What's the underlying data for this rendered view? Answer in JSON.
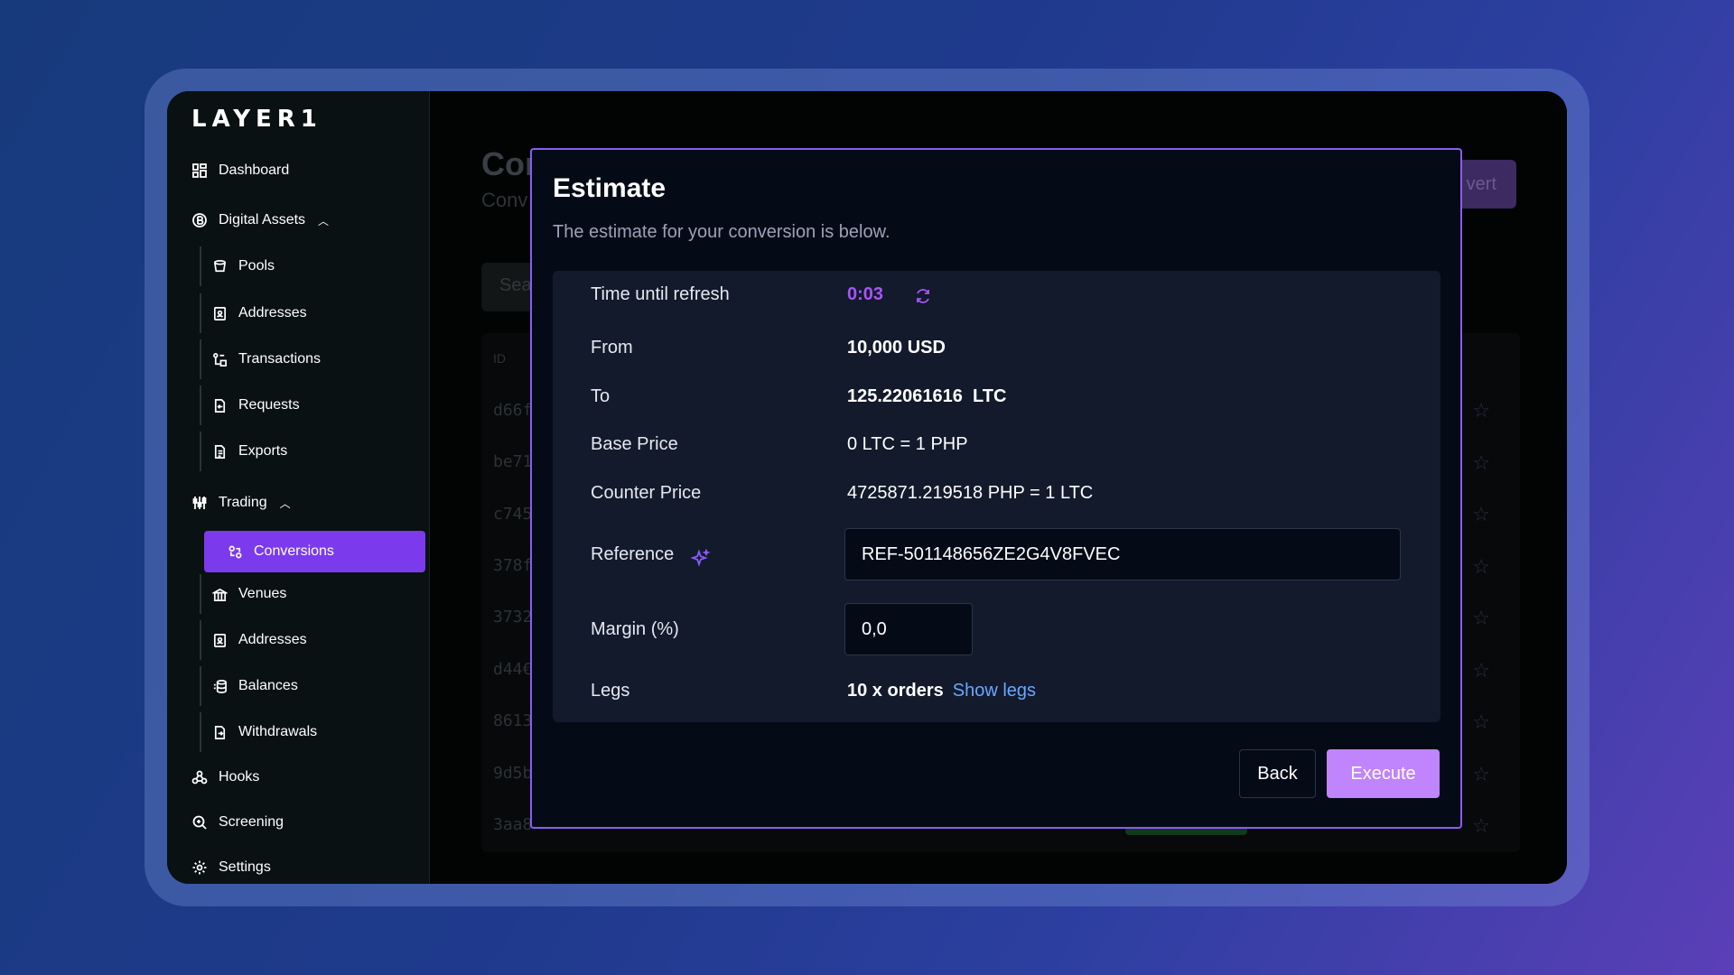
{
  "app": {
    "logo": "LAYER1"
  },
  "sidebar": {
    "dashboard": "Dashboard",
    "digital_assets": "Digital Assets",
    "digital_assets_items": [
      "Pools",
      "Addresses",
      "Transactions",
      "Requests",
      "Exports"
    ],
    "trading": "Trading",
    "trading_items": [
      "Conversions",
      "Venues",
      "Addresses",
      "Balances",
      "Withdrawals"
    ],
    "active_item": "Conversions",
    "hooks": "Hooks",
    "screening": "Screening",
    "settings": "Settings"
  },
  "background": {
    "title": "Con",
    "subtitle": "Conv",
    "button": "vert",
    "search": "Sea",
    "table_header_id": "ID",
    "row_ids": [
      "d66f",
      "be71",
      "c745",
      "378f",
      "3732",
      "d44€",
      "8613",
      "9d5b",
      "3aa8"
    ]
  },
  "modal": {
    "title": "Estimate",
    "description": "The estimate for your conversion is below.",
    "rows": {
      "refresh_label": "Time until refresh",
      "refresh_value": "0:03",
      "from_label": "From",
      "from_value": "10,000 USD",
      "to_label": "To",
      "to_value": "125.22061616  LTC",
      "base_label": "Base Price",
      "base_value": "0 LTC = 1 PHP",
      "counter_label": "Counter Price",
      "counter_value": "4725871.219518 PHP = 1 LTC",
      "reference_label": "Reference",
      "reference_value": "REF-501148656ZE2G4V8FVEC",
      "margin_label": "Margin (%)",
      "margin_value": "0,0",
      "legs_label": "Legs",
      "legs_value": "10 x orders",
      "legs_link": "Show legs"
    },
    "back_label": "Back",
    "execute_label": "Execute"
  },
  "colors": {
    "accent": "#7c3aed",
    "timer": "#a855f7",
    "execute": "#c084fc",
    "link": "#6aa7ff"
  }
}
